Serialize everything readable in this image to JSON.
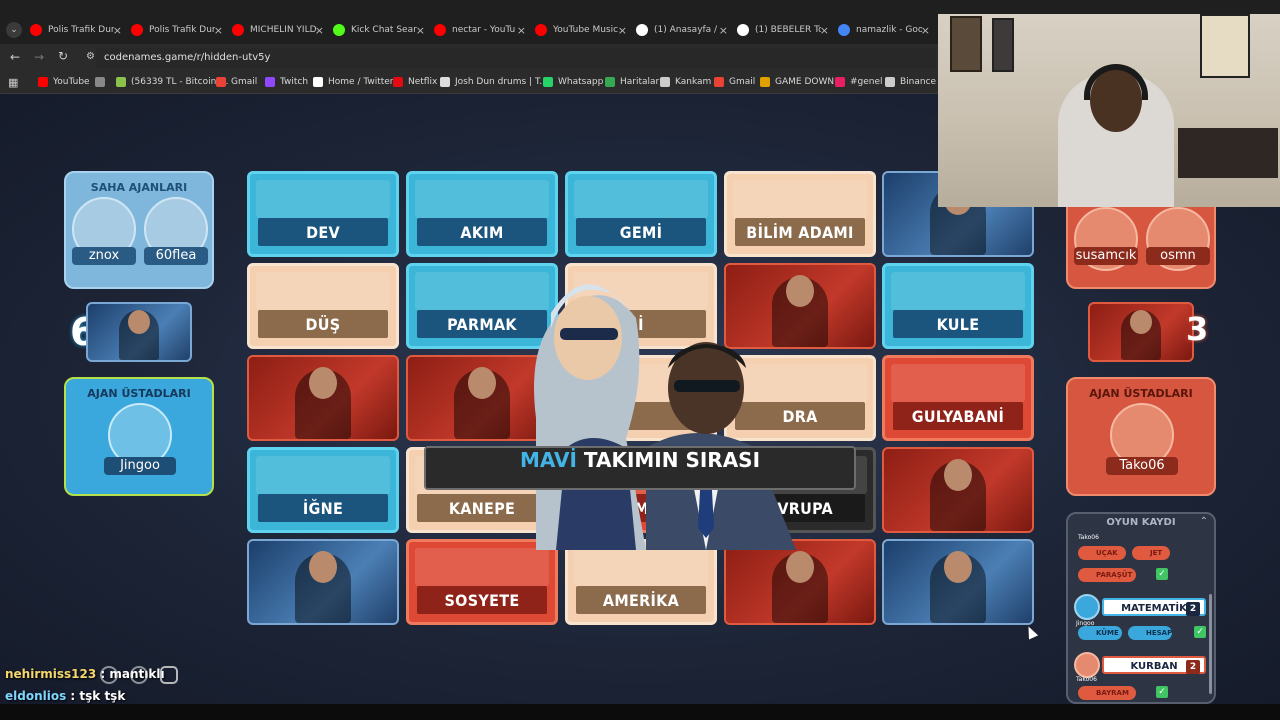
{
  "browser": {
    "tabs": [
      {
        "label": "Polis Trafik Dur",
        "icon": "youtube-icon",
        "color": "#ff0000"
      },
      {
        "label": "Polis Trafik Dur",
        "icon": "youtube-icon",
        "color": "#ff0000"
      },
      {
        "label": "MİCHELİN YILD",
        "icon": "youtube-icon",
        "color": "#ff0000"
      },
      {
        "label": "Kick Chat Searc",
        "icon": "kick-icon",
        "color": "#53fc18"
      },
      {
        "label": "nectar - YouTu",
        "icon": "youtube-icon",
        "color": "#ff0000"
      },
      {
        "label": "YouTube Music",
        "icon": "youtube-music-icon",
        "color": "#ff0000"
      },
      {
        "label": "(1) Anasayfa / X",
        "icon": "x-icon",
        "color": "#ffffff"
      },
      {
        "label": "(1) BEBELER To",
        "icon": "x-icon",
        "color": "#ffffff"
      },
      {
        "label": "namazlik - Goo",
        "icon": "google-icon",
        "color": "#4285f4"
      }
    ],
    "url": "codenames.game/r/hidden-utv5y",
    "bookmarks": [
      {
        "label": "YouTube",
        "color": "#ff0000"
      },
      {
        "label": "",
        "color": "#888888"
      },
      {
        "label": "(56339 TL - Bitcoin)...",
        "color": "#8bc34a"
      },
      {
        "label": "Gmail",
        "color": "#ea4335"
      },
      {
        "label": "Twitch",
        "color": "#9146ff"
      },
      {
        "label": "Home / Twitter",
        "color": "#ffffff"
      },
      {
        "label": "Netflix",
        "color": "#e50914"
      },
      {
        "label": "Josh Dun drums | T...",
        "color": "#dddddd"
      },
      {
        "label": "Whatsapp",
        "color": "#25d366"
      },
      {
        "label": "Haritalar",
        "color": "#34a853"
      },
      {
        "label": "Kankam",
        "color": "#cccccc"
      },
      {
        "label": "Gmail",
        "color": "#ea4335"
      },
      {
        "label": "GAME DOWN",
        "color": "#e0a000"
      },
      {
        "label": "#genel",
        "color": "#e91e63"
      },
      {
        "label": "Binance",
        "color": "#cccccc"
      }
    ]
  },
  "left_team": {
    "field_title": "SAHA AJANLARI",
    "players": [
      "znox",
      "60flea"
    ],
    "remaining": "6",
    "spymaster_title": "AJAN ÜSTADLARI",
    "spymaster": "Jingoo"
  },
  "right_team": {
    "players": [
      "susamcık",
      "osmn"
    ],
    "remaining": "3",
    "spymaster_title": "AJAN ÜSTADLARI",
    "spymaster": "Tako06"
  },
  "board": {
    "row1": [
      {
        "word": "DEV",
        "color": "blue"
      },
      {
        "word": "AKIM",
        "color": "blue"
      },
      {
        "word": "GEMİ",
        "color": "blue"
      },
      {
        "word": "BİLİM ADAMI",
        "color": "beige"
      },
      {
        "word": "",
        "color": "agent-blue"
      }
    ],
    "row2": [
      {
        "word": "DÜŞ",
        "color": "beige"
      },
      {
        "word": "PARMAK",
        "color": "blue"
      },
      {
        "word": "İ",
        "color": "beige"
      },
      {
        "word": "",
        "color": "agent-red"
      },
      {
        "word": "KULE",
        "color": "blue"
      }
    ],
    "row3": [
      {
        "word": "",
        "color": "agent-red"
      },
      {
        "word": "",
        "color": "agent-red"
      },
      {
        "word": "",
        "color": "beige"
      },
      {
        "word": "DRA",
        "color": "beige"
      },
      {
        "word": "GULYABANİ",
        "color": "red"
      }
    ],
    "row4": [
      {
        "word": "İĞNE",
        "color": "blue"
      },
      {
        "word": "KANEPE",
        "color": "beige"
      },
      {
        "word": "DÜMEN",
        "color": "red"
      },
      {
        "word": "AVRUPA",
        "color": "black"
      },
      {
        "word": "",
        "color": "agent-red"
      }
    ],
    "row5": [
      {
        "word": "",
        "color": "agent-blue"
      },
      {
        "word": "SOSYETE",
        "color": "red"
      },
      {
        "word": "AMERİKA",
        "color": "beige"
      },
      {
        "word": "",
        "color": "agent-red"
      },
      {
        "word": "",
        "color": "agent-blue"
      }
    ]
  },
  "turn_banner": {
    "team": "MAVİ",
    "rest": "TAKIMIN SIRASI"
  },
  "game_log": {
    "title": "OYUN KAYDI",
    "entries": [
      {
        "player": "Tako06"
      },
      {
        "guess": "UÇAK",
        "tag": "JET"
      },
      {
        "guess": "PARAŞÜT"
      },
      {
        "clue": "MATEMATİK",
        "count": "2",
        "player": "Jingoo"
      },
      {
        "guess": "KÜME",
        "tag": "HESAP"
      },
      {
        "clue": "KURBAN",
        "count": "2",
        "player": "Tako06"
      },
      {
        "guess": "BAYRAM"
      }
    ]
  },
  "chat": [
    {
      "user": "nehirmiss123",
      "sep": " : ",
      "msg": "mantıklı",
      "color": "#f5d76e"
    },
    {
      "user": "eldonlios",
      "sep": " : ",
      "msg": "tşk tşk",
      "color": "#7ed6ff"
    }
  ],
  "colors": {
    "blue": "#3bb6d8",
    "red": "#de4936",
    "beige": "#f4d0b0",
    "accent_blue": "#42b4e6"
  }
}
